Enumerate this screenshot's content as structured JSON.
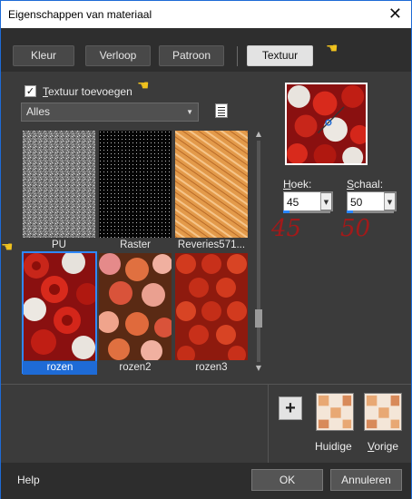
{
  "window": {
    "title": "Eigenschappen van materiaal",
    "close_glyph": "✕"
  },
  "tabs": [
    {
      "label": "Kleur"
    },
    {
      "label": "Verloop"
    },
    {
      "label": "Patroon"
    },
    {
      "label": "Textuur",
      "active": true
    }
  ],
  "texture": {
    "checkbox_label_prefix": "T",
    "checkbox_label_rest": "extuur toevoegen",
    "checked": true,
    "category": "Alles"
  },
  "thumbnails": [
    {
      "label": "PU"
    },
    {
      "label": "Raster"
    },
    {
      "label": "Reveries571..."
    },
    {
      "label": "rozen",
      "selected": true
    },
    {
      "label": "rozen2"
    },
    {
      "label": "rozen3"
    }
  ],
  "angle": {
    "label_hot": "H",
    "label_rest": "oek:",
    "value": "45",
    "annotation": "45"
  },
  "scale": {
    "label_hot": "S",
    "label_rest": "chaal:",
    "value": "50",
    "annotation": "50"
  },
  "current": {
    "label": "Huidige"
  },
  "previous": {
    "label_hot": "V",
    "label_rest": "orige"
  },
  "footer": {
    "help": "Help",
    "ok": "OK",
    "cancel": "Annuleren"
  },
  "colors": {
    "accent": "#1e6bd6",
    "annotation": "#a11a1a",
    "hand": "#f0c21e"
  },
  "icons": {
    "pointer": "pointing-hand-icon",
    "browse": "texture-folder-icon",
    "plus": "add-icon"
  }
}
